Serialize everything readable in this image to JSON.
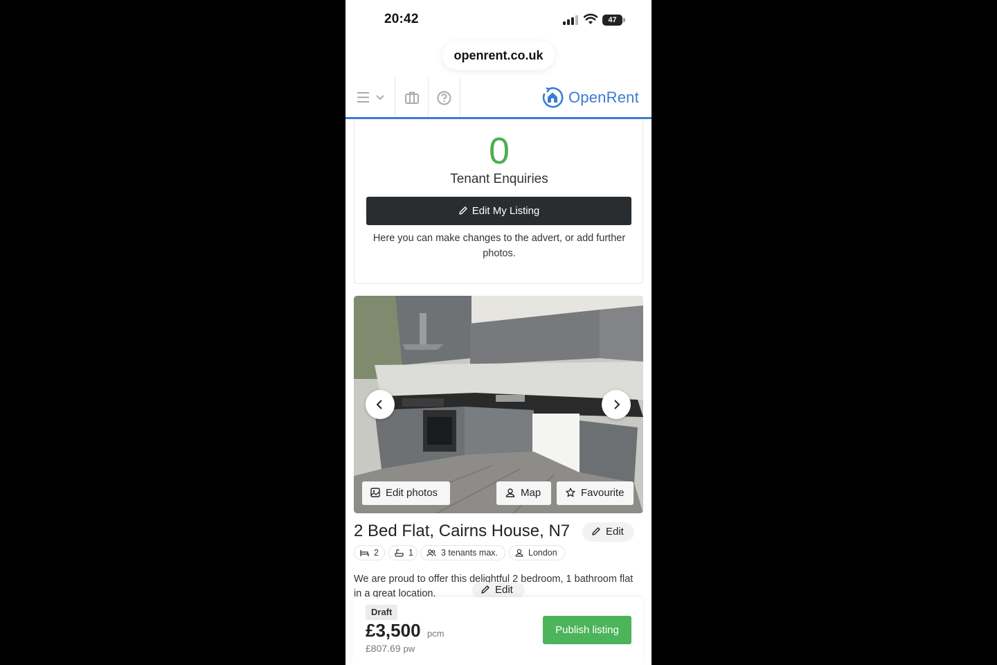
{
  "status_bar": {
    "time": "20:42",
    "battery": "47"
  },
  "browser": {
    "url": "openrent.co.uk"
  },
  "site_nav": {
    "logo_text": "OpenRent",
    "accent": "#3a7bd5"
  },
  "enquiries": {
    "count": "0",
    "label": "Tenant Enquiries",
    "edit_listing_label": "Edit My Listing",
    "description": "Here you can make changes to the advert, or add further photos."
  },
  "gallery": {
    "edit_photos_label": "Edit photos",
    "map_label": "Map",
    "favourite_label": "Favourite"
  },
  "listing": {
    "title": "2 Bed Flat, Cairns House, N7",
    "edit_label": "Edit",
    "chips": {
      "beds": "2",
      "baths": "1",
      "tenants": "3 tenants max.",
      "location": "London"
    },
    "description": "We are proud to offer this delightful 2 bedroom, 1 bathroom flat in a great location.",
    "description_edit_label": "Edit"
  },
  "footer_bar": {
    "status": "Draft",
    "price": "£3,500",
    "price_unit": "pcm",
    "weekly_price": "£807.69",
    "weekly_unit": "pw",
    "publish_label": "Publish listing",
    "publish_color": "#4cb45a"
  }
}
